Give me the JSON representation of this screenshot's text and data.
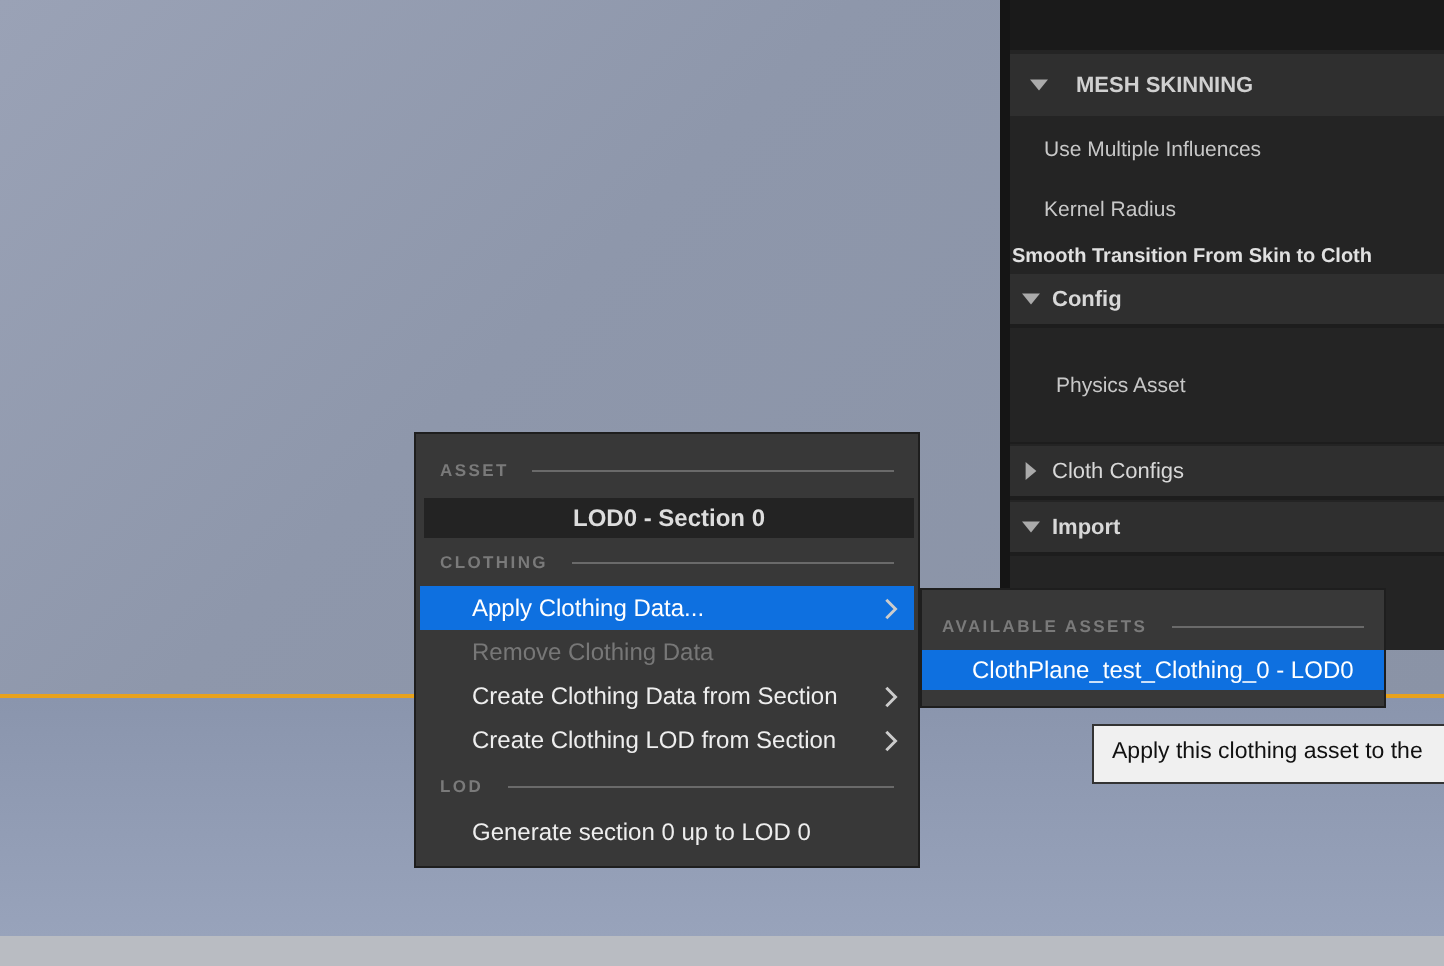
{
  "details_panel": {
    "sections": [
      {
        "kind": "category",
        "label": "MESH SKINNING",
        "expanded": true
      },
      {
        "kind": "property",
        "label": "Use Multiple Influences"
      },
      {
        "kind": "property",
        "label": "Kernel Radius"
      },
      {
        "kind": "heading",
        "label": "Smooth Transition From Skin to Cloth"
      },
      {
        "kind": "group",
        "label": "Config",
        "expanded": true
      },
      {
        "kind": "tall",
        "label": "Physics Asset"
      },
      {
        "kind": "group",
        "label": "Cloth Configs",
        "expanded": false
      },
      {
        "kind": "group",
        "label": "Import",
        "expanded": true
      }
    ]
  },
  "context_menu": {
    "items": [
      {
        "kind": "section",
        "label": "ASSET"
      },
      {
        "kind": "title",
        "label": "LOD0 - Section 0"
      },
      {
        "kind": "section",
        "label": "CLOTHING"
      },
      {
        "kind": "entry",
        "label": "Apply Clothing Data...",
        "selected": true,
        "disabled": false,
        "submenu": true
      },
      {
        "kind": "entry",
        "label": "Remove Clothing Data",
        "selected": false,
        "disabled": true,
        "submenu": false
      },
      {
        "kind": "entry",
        "label": "Create Clothing Data from Section",
        "selected": false,
        "disabled": false,
        "submenu": true
      },
      {
        "kind": "entry",
        "label": "Create Clothing LOD from Section",
        "selected": false,
        "disabled": false,
        "submenu": true
      },
      {
        "kind": "section",
        "label": "LOD"
      },
      {
        "kind": "entry",
        "label": "Generate section 0 up to LOD 0",
        "selected": false,
        "disabled": false,
        "submenu": false
      }
    ]
  },
  "submenu": {
    "heading": "AVAILABLE ASSETS",
    "items": [
      {
        "label": "ClothPlane_test_Clothing_0 - LOD0",
        "selected": true
      }
    ]
  },
  "tooltip": {
    "text": "Apply this clothing asset to the"
  }
}
